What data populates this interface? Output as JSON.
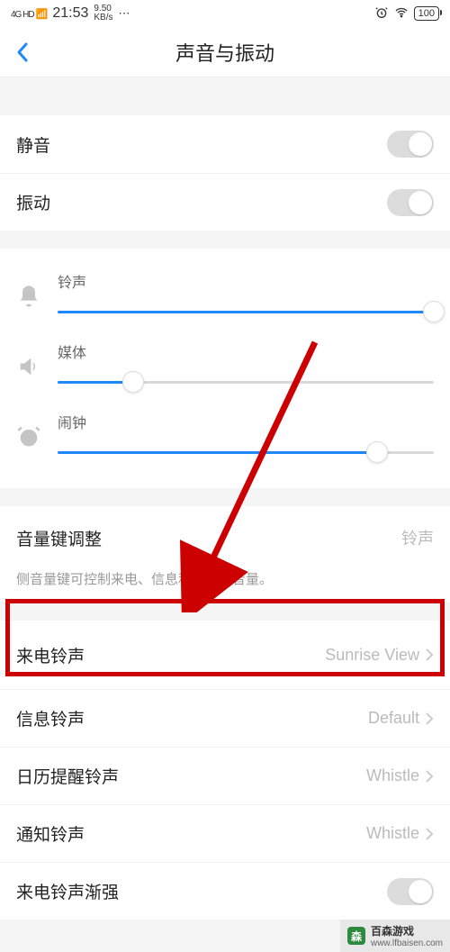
{
  "status": {
    "network": "4G HD",
    "time": "21:53",
    "net_speed_top": "9.50",
    "net_speed_bot": "KB/s",
    "dots": "⋯",
    "battery": "100"
  },
  "header": {
    "title": "声音与振动"
  },
  "toggles": {
    "mute": {
      "label": "静音",
      "on": false
    },
    "vibrate": {
      "label": "振动",
      "on": false
    }
  },
  "sliders": {
    "ringtone": {
      "label": "铃声",
      "value": 100
    },
    "media": {
      "label": "媒体",
      "value": 20
    },
    "alarm": {
      "label": "闹钟",
      "value": 85
    }
  },
  "volume_key": {
    "label": "音量键调整",
    "value": "铃声",
    "hint": "侧音量键可控制来电、信息和通知的音量。"
  },
  "ringtones": {
    "incoming": {
      "label": "来电铃声",
      "value": "Sunrise View"
    },
    "message": {
      "label": "信息铃声",
      "value": "Default"
    },
    "calendar": {
      "label": "日历提醒铃声",
      "value": "Whistle"
    },
    "notification": {
      "label": "通知铃声",
      "value": "Whistle"
    },
    "ascending": {
      "label": "来电铃声渐强",
      "on": false
    }
  },
  "watermark": {
    "brand": "百森游戏",
    "url": "www.lfbaisen.com"
  }
}
